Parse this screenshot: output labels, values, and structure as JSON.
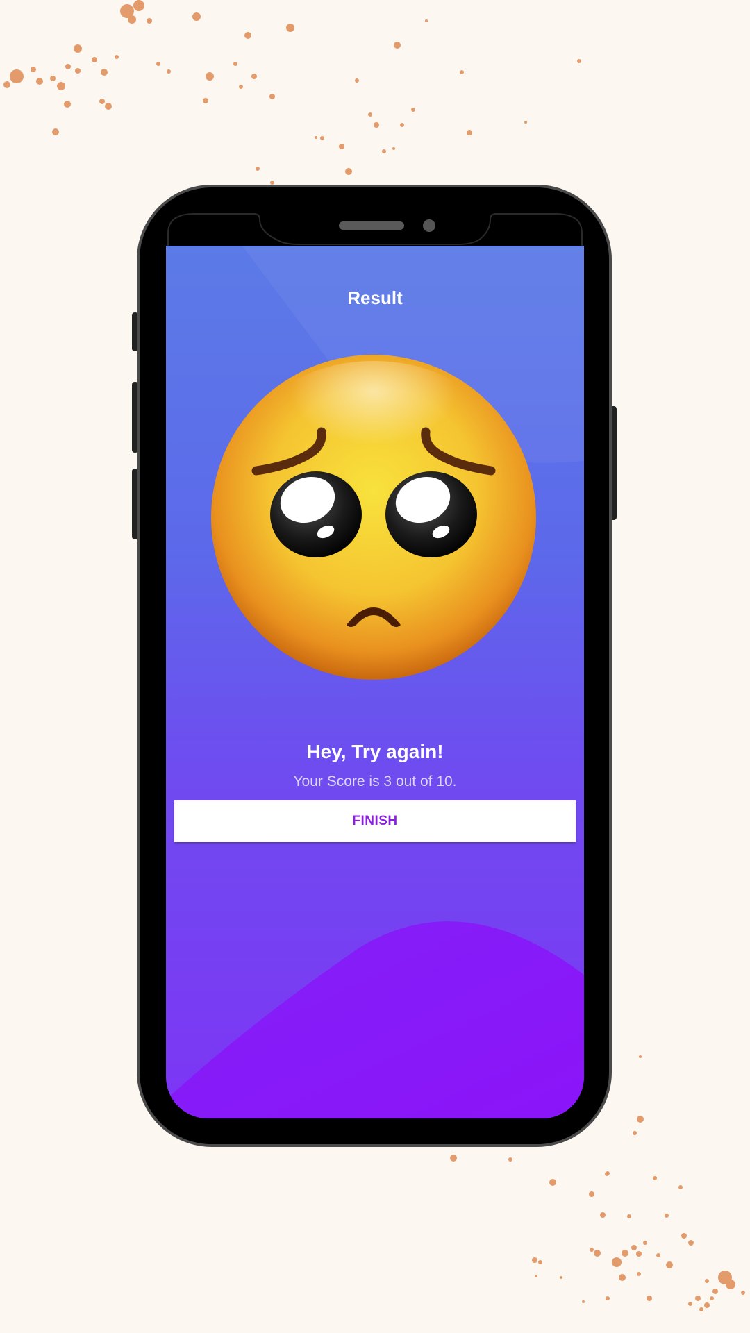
{
  "screen": {
    "title": "Result",
    "heading": "Hey, Try again!",
    "score_text": "Your Score is 3 out of 10.",
    "finish_label": "FINISH",
    "result_icon": "pleading-face-icon"
  },
  "colors": {
    "background": "#fdf7f2",
    "splatter": "#e39b6c",
    "gradient_top": "#5c7be7",
    "gradient_bottom": "#7d35f4",
    "wave": "#8b1cf7",
    "button_text": "#8a1fe0"
  }
}
